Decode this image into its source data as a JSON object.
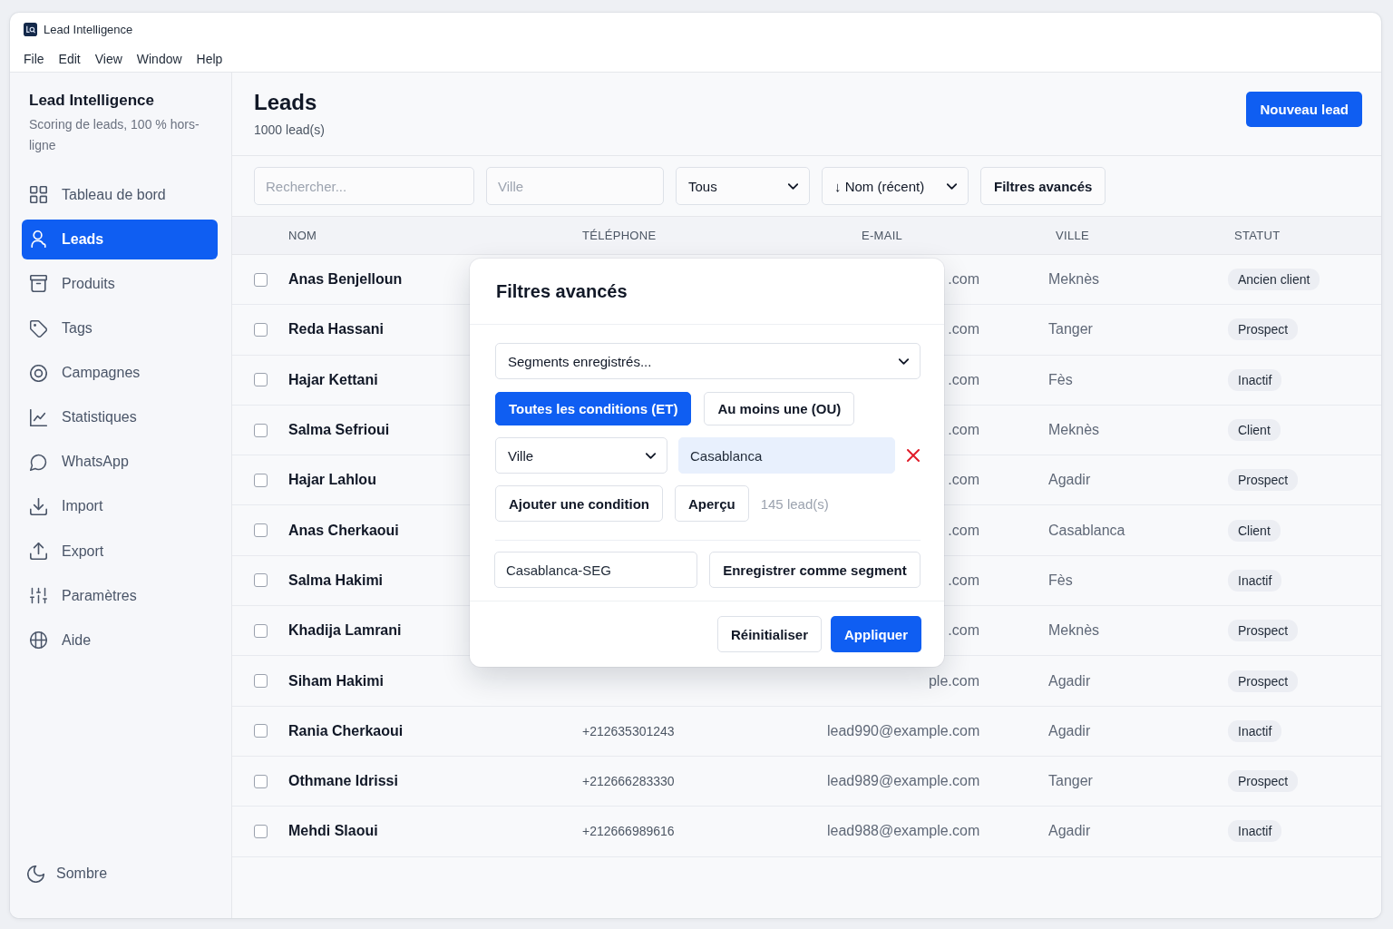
{
  "window": {
    "title": "Lead Intelligence"
  },
  "menu": [
    "File",
    "Edit",
    "View",
    "Window",
    "Help"
  ],
  "sidebar": {
    "brand": "Lead Intelligence",
    "tagline": "Scoring de leads, 100 % hors-ligne",
    "items": [
      {
        "label": "Tableau de bord",
        "selected": false
      },
      {
        "label": "Leads",
        "selected": true
      },
      {
        "label": "Produits",
        "selected": false
      },
      {
        "label": "Tags",
        "selected": false
      },
      {
        "label": "Campagnes",
        "selected": false
      },
      {
        "label": "Statistiques",
        "selected": false
      },
      {
        "label": "WhatsApp",
        "selected": false
      },
      {
        "label": "Import",
        "selected": false
      },
      {
        "label": "Export",
        "selected": false
      },
      {
        "label": "Paramètres",
        "selected": false
      },
      {
        "label": "Aide",
        "selected": false
      }
    ],
    "theme_toggle": "Sombre"
  },
  "header": {
    "title": "Leads",
    "count": "1000 lead(s)",
    "new_button": "Nouveau lead"
  },
  "filters": {
    "search": {
      "placeholder": "Rechercher..."
    },
    "city": {
      "placeholder": "Ville"
    },
    "status_select": {
      "value": "Tous"
    },
    "sort_select": {
      "value": "↓ Nom (récent)"
    },
    "advanced_button": "Filtres avancés"
  },
  "table": {
    "columns": [
      "NOM",
      "TÉLÉPHONE",
      "E-MAIL",
      "VILLE",
      "STATUT"
    ],
    "rows": [
      {
        "checked": false,
        "name": "Anas Benjelloun",
        "email": ".com",
        "city": "Meknès",
        "status": "Ancien client"
      },
      {
        "checked": false,
        "name": "Reda Hassani",
        "email": ".com",
        "city": "Tanger",
        "status": "Prospect"
      },
      {
        "checked": false,
        "name": "Hajar Kettani",
        "email": ".com",
        "city": "Fès",
        "status": "Inactif"
      },
      {
        "checked": false,
        "name": "Salma Sefrioui",
        "email": ".com",
        "city": "Meknès",
        "status": "Client"
      },
      {
        "checked": false,
        "name": "Hajar Lahlou",
        "email": ".com",
        "city": "Agadir",
        "status": "Prospect"
      },
      {
        "checked": false,
        "name": "Anas Cherkaoui",
        "email": ".com",
        "city": "Casablanca",
        "status": "Client"
      },
      {
        "checked": false,
        "name": "Salma Hakimi",
        "email": ".com",
        "city": "Fès",
        "status": "Inactif"
      },
      {
        "checked": false,
        "name": "Khadija Lamrani",
        "email": ".com",
        "city": "Meknès",
        "status": "Prospect"
      },
      {
        "checked": false,
        "name": "Siham Hakimi",
        "email": "ple.com",
        "city": "Agadir",
        "status": "Prospect"
      },
      {
        "checked": false,
        "name": "Rania Cherkaoui",
        "phone": "+212635301243",
        "email": "lead990@example.com",
        "city": "Agadir",
        "status": "Inactif"
      },
      {
        "checked": false,
        "name": "Othmane Idrissi",
        "phone": "+212666283330",
        "email": "lead989@example.com",
        "city": "Tanger",
        "status": "Prospect"
      },
      {
        "checked": false,
        "name": "Mehdi Slaoui",
        "phone": "+212666989616",
        "email": "lead988@example.com",
        "city": "Agadir",
        "status": "Inactif"
      }
    ]
  },
  "dialog": {
    "title": "Filtres avancés",
    "segment_select": {
      "value": "Segments enregistrés..."
    },
    "match_modes": [
      {
        "label": "Toutes les conditions (ET)",
        "selected": true
      },
      {
        "label": "Au moins une (OU)",
        "selected": false
      }
    ],
    "conditions": [
      {
        "field": "Ville",
        "value": "Casablanca"
      }
    ],
    "add_condition_button": "Ajouter une condition",
    "preview_button": "Aperçu",
    "preview_count": "145 lead(s)",
    "segment_name": {
      "value": "Casablanca-SEG"
    },
    "save_segment_button": "Enregistrer comme segment",
    "reset_button": "Réinitialiser",
    "apply_button": "Appliquer"
  }
}
